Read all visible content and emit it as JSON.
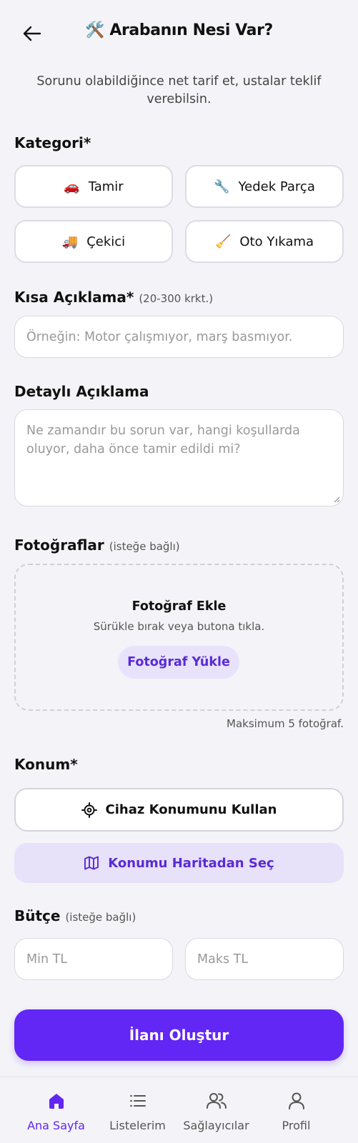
{
  "header": {
    "title": "🛠️ Arabanın Nesi Var?",
    "subtitle": "Sorunu olabildiğince net tarif et, ustalar teklif verebilsin."
  },
  "category": {
    "label": "Kategori*",
    "options": [
      {
        "emoji": "🚗",
        "label": "Tamir"
      },
      {
        "emoji": "🔧",
        "label": "Yedek Parça"
      },
      {
        "emoji": "🚚",
        "label": "Çekici"
      },
      {
        "emoji": "🧹",
        "label": "Oto Yıkama"
      }
    ]
  },
  "short_desc": {
    "label": "Kısa Açıklama*",
    "hint": "(20-300 krkt.)",
    "placeholder": "Örneğin: Motor çalışmıyor, marş basmıyor."
  },
  "detail_desc": {
    "label": "Detaylı Açıklama",
    "placeholder": "Ne zamandır bu sorun var, hangi koşullarda oluyor, daha önce tamir edildi mi?"
  },
  "photos": {
    "label": "Fotoğraflar",
    "hint": "(isteğe bağlı)",
    "drop_title": "Fotoğraf Ekle",
    "drop_sub": "Sürükle bırak veya butona tıkla.",
    "upload_button": "Fotoğraf Yükle",
    "max_note": "Maksimum 5 fotoğraf."
  },
  "location": {
    "label": "Konum*",
    "device_button": "Cihaz Konumunu Kullan",
    "map_button": "Konumu Haritadan Seç"
  },
  "budget": {
    "label": "Bütçe",
    "hint": "(isteğe bağlı)",
    "min_placeholder": "Min TL",
    "max_placeholder": "Maks TL"
  },
  "submit_label": "İlanı Oluştur",
  "tabbar": {
    "items": [
      {
        "label": "Ana Sayfa",
        "icon": "home-icon",
        "active": true
      },
      {
        "label": "Listelerim",
        "icon": "list-icon",
        "active": false
      },
      {
        "label": "Sağlayıcılar",
        "icon": "users-icon",
        "active": false
      },
      {
        "label": "Profil",
        "icon": "user-icon",
        "active": false
      }
    ]
  },
  "colors": {
    "accent": "#6226f5",
    "accent_soft": "#e7e1f9",
    "background": "#f4f4f8"
  }
}
